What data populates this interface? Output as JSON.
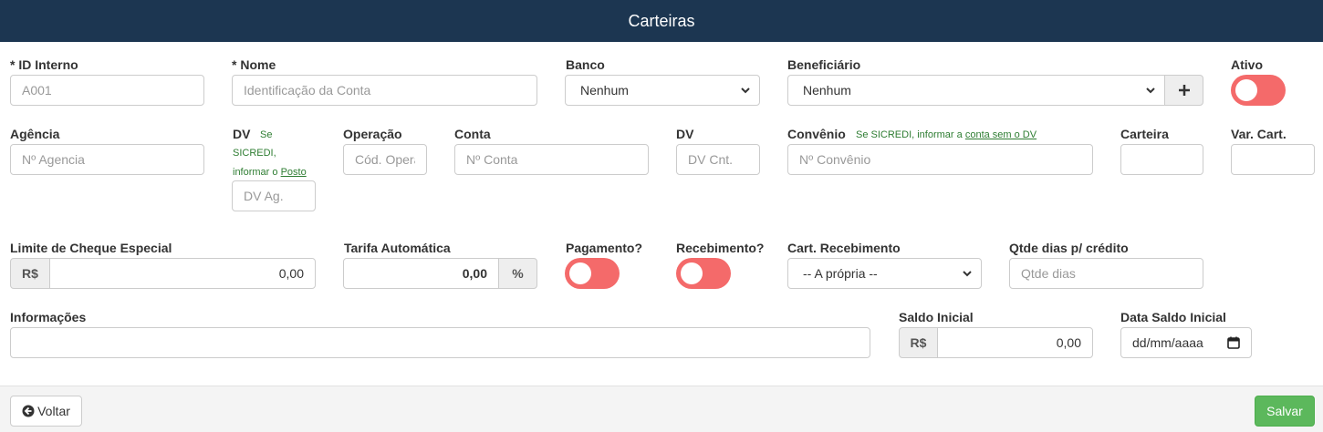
{
  "header": {
    "title": "Carteiras"
  },
  "fields": {
    "id_interno": {
      "label": "* ID Interno",
      "placeholder": "A001"
    },
    "nome": {
      "label": "* Nome",
      "placeholder": "Identificação da Conta"
    },
    "banco": {
      "label": "Banco",
      "value": "Nenhum"
    },
    "beneficiario": {
      "label": "Beneficiário",
      "value": "Nenhum",
      "add_icon": "plus-icon"
    },
    "ativo": {
      "label": "Ativo",
      "on": false
    },
    "agencia": {
      "label": "Agência",
      "placeholder": "Nº Agencia"
    },
    "dv_agencia": {
      "label": "DV",
      "hint_1": "Se",
      "hint_2": "SICREDI,",
      "hint_3": "informar o",
      "hint_link": "Posto",
      "placeholder": "DV Ag."
    },
    "operacao": {
      "label": "Operação",
      "placeholder": "Cód. Operação"
    },
    "conta": {
      "label": "Conta",
      "placeholder": "Nº Conta"
    },
    "dv_conta": {
      "label": "DV",
      "placeholder": "DV Cnt."
    },
    "convenio": {
      "label": "Convênio",
      "hint": "Se SICREDI, informar a",
      "hint_link": "conta sem o DV",
      "placeholder": "Nº Convênio"
    },
    "carteira": {
      "label": "Carteira",
      "value": ""
    },
    "var_cart": {
      "label": "Var. Cart.",
      "value": ""
    },
    "limite": {
      "label": "Limite de Cheque Especial",
      "prefix": "R$",
      "value": "0,00"
    },
    "tarifa": {
      "label": "Tarifa Automática",
      "value": "0,00",
      "suffix": "%"
    },
    "pagamento": {
      "label": "Pagamento?",
      "on": false
    },
    "recebimento": {
      "label": "Recebimento?",
      "on": false
    },
    "cart_recebimento": {
      "label": "Cart. Recebimento",
      "value": "-- A própria --"
    },
    "qtde_dias": {
      "label": "Qtde dias p/ crédito",
      "placeholder": "Qtde dias"
    },
    "informacoes": {
      "label": "Informações",
      "value": ""
    },
    "saldo_inicial": {
      "label": "Saldo Inicial",
      "prefix": "R$",
      "value": "0,00"
    },
    "data_saldo": {
      "label": "Data Saldo Inicial",
      "value": "dd/mm/aaaa",
      "icon": "calendar-icon"
    }
  },
  "footer": {
    "back_label": "Voltar",
    "back_icon": "arrow-circle-left-icon",
    "save_label": "Salvar"
  },
  "colors": {
    "header_bg": "#1c3651",
    "toggle_off": "#f46a6a",
    "hint_green": "#2e7d32",
    "save_green": "#5cb85c"
  }
}
